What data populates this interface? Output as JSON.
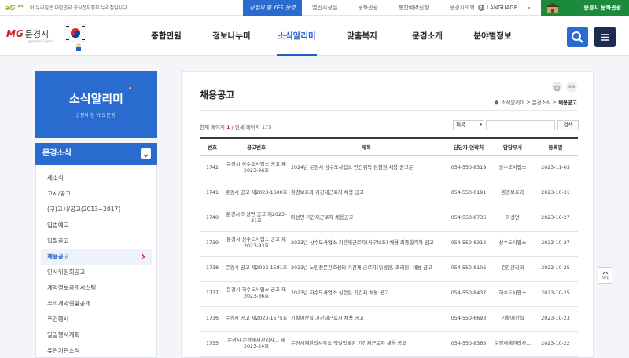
{
  "topbar": {
    "gov_notice": "이 누리집은 대한민국 공식전자정부 누리집입니다.",
    "yes_slogan": "긍정의 힘 YES 문경",
    "links": [
      "열린시정실",
      "문화관광",
      "통합예약신청",
      "문경시의회"
    ],
    "language": "LANGUAGE",
    "culture": "문경시 문화관광"
  },
  "header": {
    "logo_mg": "MG",
    "logo_name": "문경시",
    "logo_url": "gyeongsiui.go.kr",
    "nav": [
      "종합민원",
      "정보나누미",
      "소식알리미",
      "맞춤복지",
      "문경소개",
      "분야별정보"
    ],
    "active_nav_index": 2
  },
  "sidebar": {
    "title": "소식알리미",
    "slogan": "긍정의 힘 YES 문경!",
    "section": "문경소식",
    "items": [
      {
        "label": "새소식",
        "active": false
      },
      {
        "label": "고시/공고",
        "active": false
      },
      {
        "label": "(구)고시/공고(2013~2017)",
        "active": false
      },
      {
        "label": "입법예고",
        "active": false
      },
      {
        "label": "입찰공고",
        "active": false
      },
      {
        "label": "채용공고",
        "active": true
      },
      {
        "label": "인사위원회공고",
        "active": false
      },
      {
        "label": "계약정보공개시스템",
        "active": false
      },
      {
        "label": "수의계약현황공개",
        "active": false
      },
      {
        "label": "주간행사",
        "active": false
      },
      {
        "label": "일일행사계획",
        "active": false
      },
      {
        "label": "유관기관소식",
        "active": false
      }
    ]
  },
  "content": {
    "sns_label": "SNS",
    "title": "채용공고",
    "breadcrumb": [
      "소식알리미",
      "문경소식",
      "채용공고"
    ],
    "page_info": {
      "prefix": "현재 페이지 ",
      "current": "1",
      "middle": " / 전체 페이지 ",
      "total": "175"
    },
    "search": {
      "field": "제목",
      "keyword": "",
      "button": "검색"
    },
    "columns": [
      "번호",
      "공고번호",
      "제목",
      "담당자 연락처",
      "담당부서",
      "등록일"
    ],
    "rows": [
      {
        "no": "1742",
        "notice": "문경시 상수도사업소 공고 제2023-96호",
        "subject": "2024년 문경시 상수도사업소 민간위탁 검침원 채용 공고문",
        "phone": "054-550-8318",
        "dept": "상수도사업소",
        "date": "2023-11-03"
      },
      {
        "no": "1741",
        "notice": "문경시 공고 제2023-1600호",
        "subject": "환경보호과 기간제근로자 채용 공고",
        "phone": "054-550-6191",
        "dept": "환경보호과",
        "date": "2023-10-31"
      },
      {
        "no": "1740",
        "notice": "문경시 마성면 공고 제2023-31호",
        "subject": "마성면 기간제근로자 채용공고",
        "phone": "054-550-8736",
        "dept": "마성면",
        "date": "2023-10-27"
      },
      {
        "no": "1739",
        "notice": "문경시 상수도사업소 공고 제2023-93호",
        "subject": "2023년 상수도사업소 기간제근로자(사무보조) 채용 최종합격자 공고",
        "phone": "054-550-8312",
        "dept": "상수도사업소",
        "date": "2023-10-27"
      },
      {
        "no": "1738",
        "notice": "문경시 공고 제2023-1581호",
        "subject": "2023년 노인전문간호센터 기간제 근로자(위생원, 조리원) 채용 공고",
        "phone": "054-550-8106",
        "dept": "건강관리과",
        "date": "2023-10-25"
      },
      {
        "no": "1737",
        "notice": "문경시 하수도사업소 공고 제2023-36호",
        "subject": "2023년 하수도사업소 실험실 기간제 채용 공고",
        "phone": "054-550-8437",
        "dept": "하수도사업소",
        "date": "2023-10-25"
      },
      {
        "no": "1736",
        "notice": "문경시 공고 제2023-1575호",
        "subject": "기획예산실 기간제근로자 채용 공고",
        "phone": "054-550-6693",
        "dept": "기획예산실",
        "date": "2023-10-23"
      },
      {
        "no": "1735",
        "notice": "문경시 문경새재관리사... 제2023-24호",
        "subject": "문경새재관리사무소 옛길박물관 기간제근로자 채용 공고",
        "phone": "054-550-8365",
        "dept": "문경새재관리사...",
        "date": "2023-10-22"
      }
    ]
  },
  "top_button": "꼭대",
  "colors": {
    "primary": "#2a6bd0",
    "navy": "#1f2c50",
    "green": "#1b8a3b",
    "red": "#d4202e"
  }
}
